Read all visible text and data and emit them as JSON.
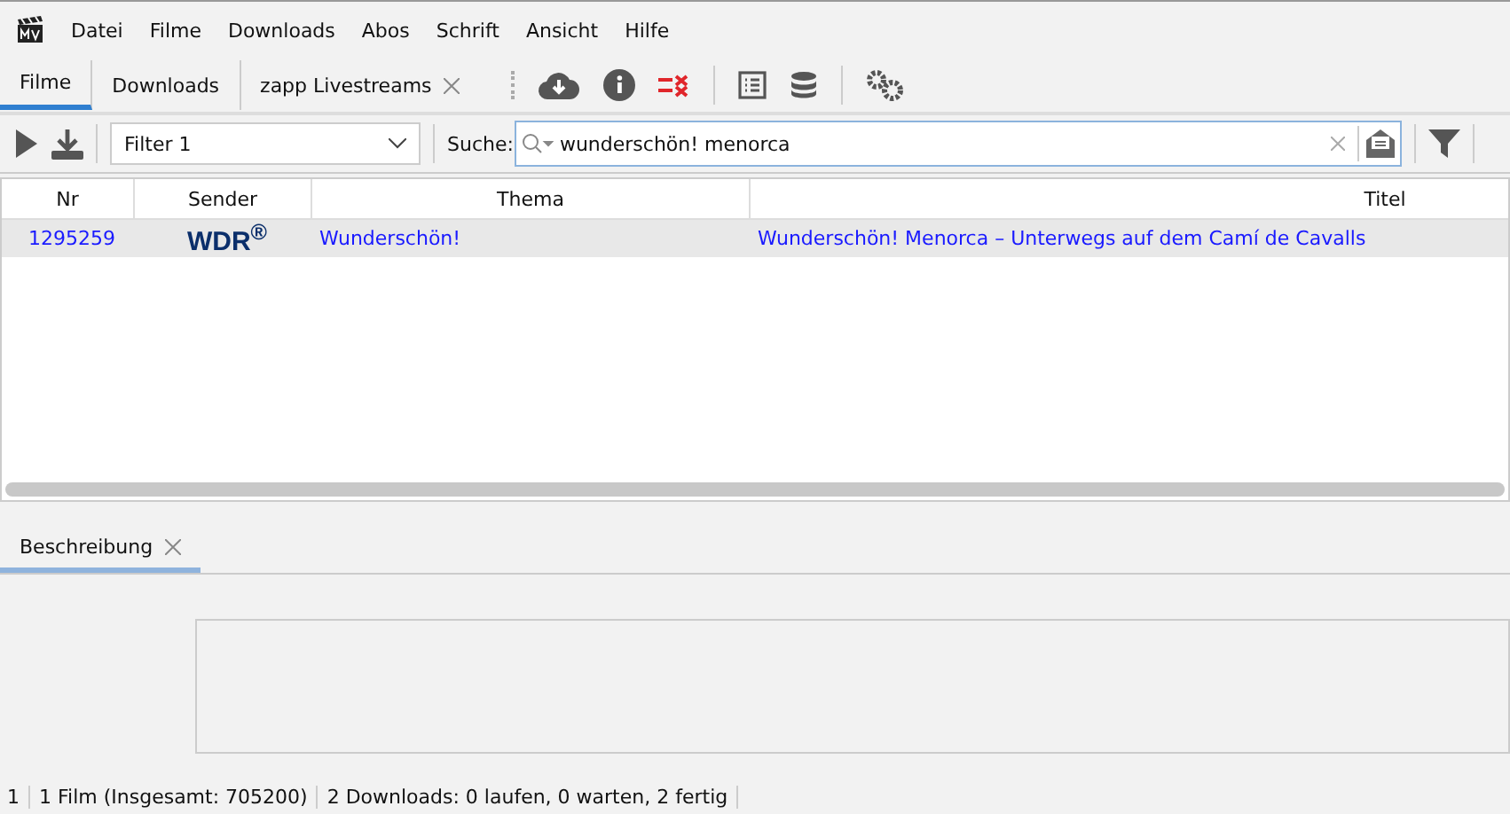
{
  "menu": [
    "Datei",
    "Filme",
    "Downloads",
    "Abos",
    "Schrift",
    "Ansicht",
    "Hilfe"
  ],
  "tabs": [
    {
      "label": "Filme",
      "selected": true,
      "closable": false
    },
    {
      "label": "Downloads",
      "selected": false,
      "closable": false
    },
    {
      "label": "zapp Livestreams",
      "selected": false,
      "closable": true
    }
  ],
  "filter": {
    "value": "Filter 1"
  },
  "search": {
    "label": "Suche:",
    "value": "wunderschön! menorca"
  },
  "table": {
    "columns": [
      "Nr",
      "Sender",
      "Thema",
      "Titel"
    ],
    "rows": [
      {
        "nr": "1295259",
        "sender": "WDR$^{®}$",
        "thema": "Wunderschön!",
        "titel": "Wunderschön! Menorca – Unterwegs auf dem Camí de Cavalls",
        "selected": true
      }
    ]
  },
  "detail_tabs": [
    {
      "label": "Beschreibung",
      "selected": true
    }
  ],
  "status_bar": [
    "1",
    "1 Film (Insgesamt: 705200)",
    "2 Downloads: 0 laufen, 0 warten, 2 fertig"
  ]
}
